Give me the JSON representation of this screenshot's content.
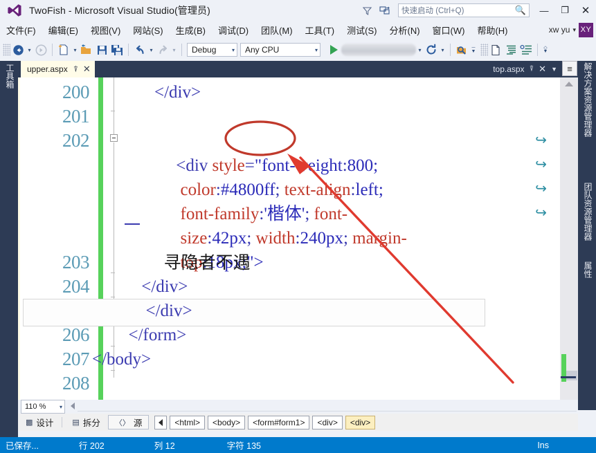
{
  "window": {
    "title": "TwoFish - Microsoft Visual Studio(管理员)",
    "logo_icon": "visual-studio-logo-icon",
    "minimize_label": "—",
    "maximize_label": "❐",
    "close_label": "✕"
  },
  "titlebar_icons": [
    {
      "name": "feedback-funnel-icon",
      "glyph": "▽"
    },
    {
      "name": "send-feedback-icon",
      "glyph": "⌸"
    }
  ],
  "quick_launch": {
    "placeholder": "快速启动 (Ctrl+Q)",
    "value": "",
    "search_icon": "magnifier-icon"
  },
  "menu": {
    "items": [
      {
        "label": "文件(F)",
        "name": "menu-file"
      },
      {
        "label": "编辑(E)",
        "name": "menu-edit"
      },
      {
        "label": "视图(V)",
        "name": "menu-view"
      },
      {
        "label": "网站(S)",
        "name": "menu-website"
      },
      {
        "label": "生成(B)",
        "name": "menu-build"
      },
      {
        "label": "调试(D)",
        "name": "menu-debug"
      },
      {
        "label": "团队(M)",
        "name": "menu-team"
      },
      {
        "label": "工具(T)",
        "name": "menu-tools"
      },
      {
        "label": "测试(S)",
        "name": "menu-test"
      },
      {
        "label": "分析(N)",
        "name": "menu-analyze"
      },
      {
        "label": "窗口(W)",
        "name": "menu-window"
      },
      {
        "label": "帮助(H)",
        "name": "menu-help"
      }
    ],
    "user": "xw yu",
    "user_caret": "▾",
    "avatar_initials": "XY"
  },
  "toolbar": {
    "back_icon": "navigate-back-icon",
    "forward_icon": "navigate-forward-icon",
    "new_item_icon": "new-item-icon",
    "open_icon": "open-file-icon",
    "save_icon": "save-icon",
    "save_all_icon": "save-all-icon",
    "undo_icon": "undo-icon",
    "redo_icon": "redo-icon",
    "config_value": "Debug",
    "platform_value": "Any CPU",
    "run_icon": "start-debug-play-icon",
    "browser_value": "",
    "refresh_icon": "refresh-icon",
    "find_icon": "find-in-files-icon",
    "page_icon": "new-page-icon",
    "format_icon": "format-document-icon",
    "comment_icon": "comment-selection-icon",
    "caret": "▾"
  },
  "left_dock": {
    "toolbox_label": "工具箱",
    "toolbox_name": "toolbox-panel-tab"
  },
  "right_dock": {
    "tabs": [
      {
        "label": "解决方案资源管理器",
        "name": "solution-explorer-tab"
      },
      {
        "label": "团队资源管理器",
        "name": "team-explorer-tab"
      },
      {
        "label": "属性",
        "name": "properties-tab"
      }
    ]
  },
  "tabs": {
    "active": {
      "label": "upper.aspx",
      "pin_icon": "pin-icon",
      "close_icon": "close-icon"
    },
    "right": {
      "label": "top.aspx",
      "pin_icon": "pin-icon",
      "close_icon": "close-icon",
      "dropdown_icon": "chevron-down-icon"
    }
  },
  "editor": {
    "line_numbers": [
      "200",
      "201",
      "202",
      "203",
      "204",
      "205",
      "206",
      "207",
      "208"
    ],
    "lines": [
      {
        "n": "200",
        "segments": [
          {
            "t": "punct",
            "s": "        </div>"
          }
        ]
      },
      {
        "n": "201",
        "segments": [
          {
            "t": "punct",
            "s": ""
          }
        ]
      },
      {
        "n": "202a",
        "segments": [
          {
            "t": "punct",
            "s": "   <div "
          },
          {
            "t": "attr",
            "s": "style"
          },
          {
            "t": "punct",
            "s": "="
          },
          {
            "t": "str",
            "s": "\"font-weight"
          },
          {
            "t": "punct",
            "s": ":"
          },
          {
            "t": "val",
            "s": "800;"
          }
        ]
      },
      {
        "n": "202b",
        "segments": [
          {
            "t": "prop",
            "s": "    color"
          },
          {
            "t": "punct",
            "s": ":"
          },
          {
            "t": "val",
            "s": "#4800ff"
          },
          {
            "t": "punct",
            "s": "; "
          },
          {
            "t": "prop",
            "s": "text-align"
          },
          {
            "t": "punct",
            "s": ":"
          },
          {
            "t": "val",
            "s": "left;"
          }
        ]
      },
      {
        "n": "202c",
        "segments": [
          {
            "t": "prop",
            "s": "    font-family"
          },
          {
            "t": "punct",
            "s": ":"
          },
          {
            "t": "val",
            "s": "'楷体'"
          },
          {
            "t": "punct",
            "s": "; "
          },
          {
            "t": "prop",
            "s": "font-"
          }
        ]
      },
      {
        "n": "202d",
        "segments": [
          {
            "t": "prop",
            "s": "    size"
          },
          {
            "t": "punct",
            "s": ":"
          },
          {
            "t": "val",
            "s": "42px"
          },
          {
            "t": "punct",
            "s": "; "
          },
          {
            "t": "prop",
            "s": "width"
          },
          {
            "t": "punct",
            "s": ":"
          },
          {
            "t": "val",
            "s": "240px"
          },
          {
            "t": "punct",
            "s": "; "
          },
          {
            "t": "prop",
            "s": "margin-"
          }
        ]
      },
      {
        "n": "202e",
        "segments": [
          {
            "t": "prop",
            "s": "    top"
          },
          {
            "t": "punct",
            "s": ":"
          },
          {
            "t": "val",
            "s": "18px;\">"
          }
        ]
      },
      {
        "n": "203",
        "segments": [
          {
            "t": "text",
            "s": "        寻隐者不遇"
          }
        ]
      },
      {
        "n": "204",
        "segments": [
          {
            "t": "punct",
            "s": "     </div>"
          }
        ]
      },
      {
        "n": "205",
        "segments": [
          {
            "t": "punct",
            "s": "      </div>"
          }
        ]
      },
      {
        "n": "206",
        "segments": [
          {
            "t": "punct",
            "s": "  </form>"
          }
        ]
      },
      {
        "n": "207",
        "segments": [
          {
            "t": "punct",
            "s": "</body>"
          }
        ]
      },
      {
        "n": "208",
        "segments": [
          {
            "t": "punct",
            "s": ""
          }
        ]
      }
    ],
    "wrap_marker_glyph": "⏎",
    "wrap_marker_count": 4,
    "fold_glyph": "−",
    "split_button_icon": "split-view-icon"
  },
  "zoom_bar": {
    "zoom_value": "110 %",
    "caret": "▾"
  },
  "view_tabs": [
    {
      "label": "设计",
      "name": "design-view-tab",
      "icon": "design-view-icon",
      "active": false
    },
    {
      "label": "拆分",
      "name": "split-view-tab",
      "icon": "split-view-icon",
      "active": false
    },
    {
      "label": "源",
      "name": "source-view-tab",
      "icon": "source-view-icon",
      "active": true
    }
  ],
  "breadcrumb": {
    "back_icon": "breadcrumb-back-icon",
    "items": [
      {
        "label": "<html>",
        "selected": false
      },
      {
        "label": "<body>",
        "selected": false
      },
      {
        "label": "<form#form1>",
        "selected": false
      },
      {
        "label": "<div>",
        "selected": false
      },
      {
        "label": "<div>",
        "selected": true
      }
    ]
  },
  "status": {
    "saved": "已保存...",
    "line": "行 202",
    "column": "列 12",
    "chars": "字符 135",
    "mode": "Ins"
  },
  "annotations": {
    "ellipse_target": "style=",
    "arrow_color": "#e03a2f",
    "ellipse_color": "#c0392b"
  },
  "colors": {
    "accent_status": "#007acc",
    "chrome": "#eef1f7",
    "dock": "#2d3b55",
    "tab_active": "#fffce8",
    "changebar_green": "#57d25b",
    "avatar_purple": "#68217a"
  }
}
